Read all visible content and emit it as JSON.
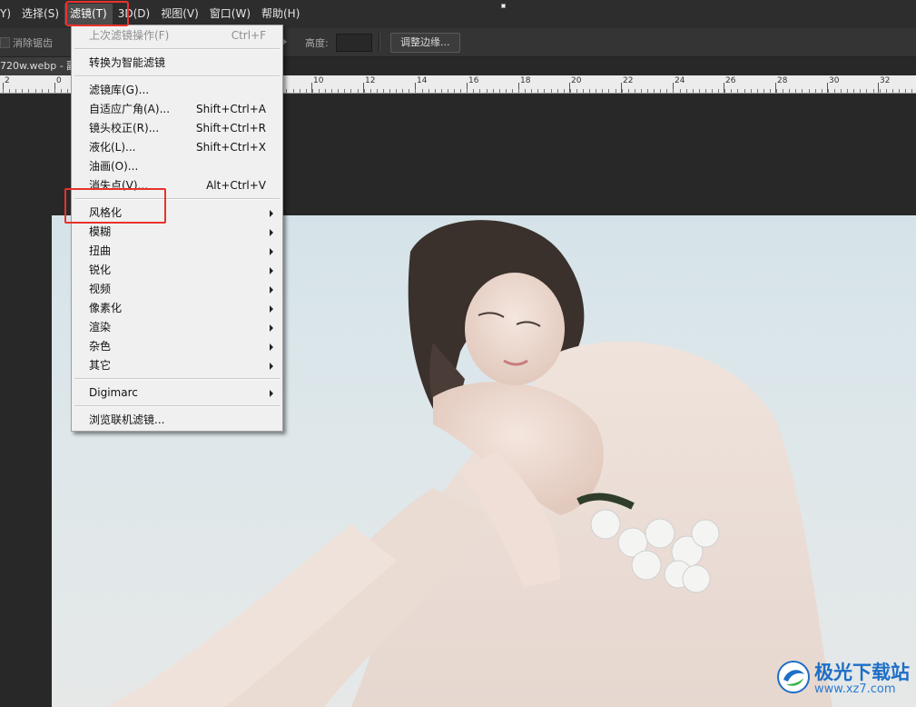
{
  "menubar": {
    "items": [
      {
        "label": "Y)"
      },
      {
        "label": "选择(S)"
      },
      {
        "label": "滤镜(T)"
      },
      {
        "label": "3D(D)"
      },
      {
        "label": "视图(V)"
      },
      {
        "label": "窗口(W)"
      },
      {
        "label": "帮助(H)"
      }
    ]
  },
  "options_bar": {
    "antialias_label": "消除锯齿",
    "height_label": "高度:",
    "refine_edge_button": "调整边缘..."
  },
  "document": {
    "tab_title": "720w.webp - 副"
  },
  "ruler": {
    "labels": [
      "2",
      "0",
      "10",
      "12",
      "14",
      "16",
      "18",
      "20",
      "22",
      "24",
      "26",
      "28",
      "30",
      "32"
    ]
  },
  "filter_menu": {
    "items": [
      {
        "label": "上次滤镜操作(F)",
        "shortcut": "Ctrl+F",
        "disabled": true
      },
      {
        "label": "转换为智能滤镜",
        "shortcut": ""
      },
      {
        "label": "滤镜库(G)...",
        "shortcut": ""
      },
      {
        "label": "自适应广角(A)...",
        "shortcut": "Shift+Ctrl+A"
      },
      {
        "label": "镜头校正(R)...",
        "shortcut": "Shift+Ctrl+R"
      },
      {
        "label": "液化(L)...",
        "shortcut": "Shift+Ctrl+X"
      },
      {
        "label": "油画(O)...",
        "shortcut": ""
      },
      {
        "label": "消失点(V)...",
        "shortcut": "Alt+Ctrl+V"
      },
      {
        "label": "风格化",
        "submenu": true
      },
      {
        "label": "模糊",
        "submenu": true
      },
      {
        "label": "扭曲",
        "submenu": true
      },
      {
        "label": "锐化",
        "submenu": true
      },
      {
        "label": "视频",
        "submenu": true
      },
      {
        "label": "像素化",
        "submenu": true
      },
      {
        "label": "渲染",
        "submenu": true
      },
      {
        "label": "杂色",
        "submenu": true
      },
      {
        "label": "其它",
        "submenu": true
      },
      {
        "label": "Digimarc",
        "submenu": true
      },
      {
        "label": "浏览联机滤镜...",
        "shortcut": ""
      }
    ]
  },
  "watermark": {
    "name": "极光下载站",
    "url": "www.xz7.com"
  },
  "colors": {
    "highlight_box": "#e8322d",
    "menu_bg": "#f0f0f0",
    "app_bg": "#282828",
    "watermark_blue": "#1d6fc7"
  }
}
